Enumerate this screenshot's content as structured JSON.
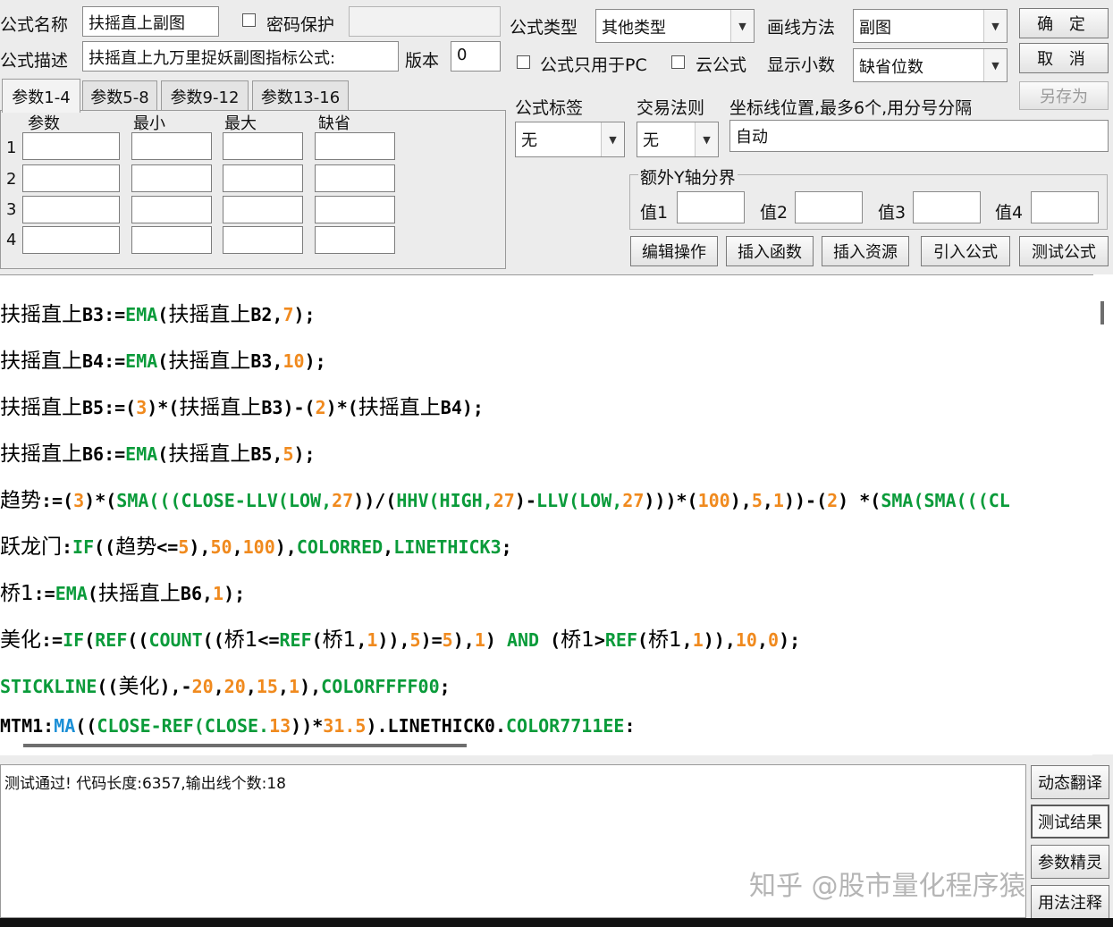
{
  "header": {
    "name_label": "公式名称",
    "name_value": "扶摇直上副图",
    "password_label": "密码保护",
    "desc_label": "公式描述",
    "desc_value": "扶摇直上九万里捉妖副图指标公式:",
    "version_label": "版本",
    "version_value": "0",
    "type_label": "公式类型",
    "type_value": "其他类型",
    "draw_label": "画线方法",
    "draw_value": "副图",
    "pc_only_label": "公式只用于PC",
    "cloud_label": "云公式",
    "decimal_label": "显示小数",
    "decimal_value": "缺省位数"
  },
  "buttons": {
    "ok": "确 定",
    "cancel": "取 消",
    "save_as": "另存为",
    "edit": "编辑操作",
    "insert_func": "插入函数",
    "insert_res": "插入资源",
    "import": "引入公式",
    "test": "测试公式"
  },
  "tabs": [
    {
      "label": "参数1-4"
    },
    {
      "label": "参数5-8"
    },
    {
      "label": "参数9-12"
    },
    {
      "label": "参数13-16"
    }
  ],
  "params": {
    "columns": [
      "参数",
      "最小",
      "最大",
      "缺省"
    ],
    "rows": [
      "1",
      "2",
      "3",
      "4"
    ]
  },
  "options": {
    "tag_label": "公式标签",
    "tag_value": "无",
    "rule_label": "交易法则",
    "rule_value": "无",
    "axis_label": "坐标线位置,最多6个,用分号分隔",
    "axis_value": "自动",
    "yaxis_group": "额外Y轴分界",
    "v1": "值1",
    "v2": "值2",
    "v3": "值3",
    "v4": "值4"
  },
  "code": {
    "l1": {
      "a": "扶摇直上",
      "b": "B3:=",
      "f": "EMA",
      "c": "(",
      "d": "扶摇直上",
      "e": "B2,",
      "n": "7",
      "g": ");"
    },
    "l2": {
      "a": "扶摇直上",
      "b": "B4:=",
      "f": "EMA",
      "c": "(",
      "d": "扶摇直上",
      "e": "B3,",
      "n": "10",
      "g": ");"
    },
    "l3": {
      "a": "扶摇直上",
      "b": "B5:=(",
      "n1": "3",
      "c": ")*(",
      "d": "扶摇直上",
      "e": "B3)-(",
      "n2": "2",
      "f": ")*(",
      "h": "扶摇直上",
      "i": "B4);"
    },
    "l4": {
      "a": "扶摇直上",
      "b": "B6:=",
      "f": "EMA",
      "c": "(",
      "d": "扶摇直上",
      "e": "B5,",
      "n": "5",
      "g": ");"
    },
    "l5": {
      "a": "趋势",
      "b": ":=(",
      "n1": "3",
      "c": ")*(",
      "f1": "SMA(((CLOSE-LLV(LOW,",
      "n2": "27",
      "c2": "))/(",
      "f2": "HHV(HIGH,",
      "n3": "27",
      "c3": ")-",
      "f3": "LLV(LOW,",
      "n4": "27",
      "c4": ")))*(",
      "n5": "100",
      "c5": "),",
      "n6": "5",
      "c6": ",",
      "n7": "1",
      "c7": "))-(",
      "n8": "2",
      "c8": ") *(",
      "f4": "SMA(SMA(((CL"
    },
    "l6": {
      "a": "跃龙门",
      "b": ":",
      "f1": "IF",
      "c": "((",
      "d": "趋势",
      "e": "<=",
      "n1": "5",
      "c2": "),",
      "n2": "50",
      "c3": ",",
      "n3": "100",
      "c4": "),",
      "f2": "COLORRED",
      "c5": ",",
      "f3": "LINETHICK3",
      "c6": ";"
    },
    "l7": {
      "a": "桥1",
      "b": ":=",
      "f": "EMA",
      "c": "(",
      "d": "扶摇直上",
      "e": "B6,",
      "n": "1",
      "g": ");"
    },
    "l8": {
      "a": "美化",
      "b": ":=",
      "f1": "IF",
      "c": "(",
      "f2": "REF",
      "c2": "((",
      "f3": "COUNT",
      "c3": "((",
      "d": "桥1",
      "e": "<=",
      "f4": "REF",
      "c4": "(",
      "d2": "桥1",
      "c5": ",",
      "n1": "1",
      "c6": ")),",
      "n2": "5",
      "c7": ")=",
      "n3": "5",
      "c8": "),",
      "n4": "1",
      "c9": ") ",
      "f5": "AND",
      "c10": " (",
      "d3": "桥1",
      "c11": ">",
      "f6": "REF",
      "c12": "(",
      "d4": "桥1",
      "c13": ",",
      "n5": "1",
      "c14": ")),",
      "n6": "10",
      "c15": ",",
      "n7": "0",
      "c16": ");"
    },
    "l9": {
      "f1": "STICKLINE",
      "c": "((",
      "d": "美化",
      "c2": "),-",
      "n1": "20",
      "c3": ",",
      "n2": "20",
      "c4": ",",
      "n3": "15",
      "c5": ",",
      "n4": "1",
      "c6": "),",
      "f2": "COLORFFFF00",
      "c7": ";"
    },
    "l10": {
      "b": "MTM1:",
      "f1": "MA",
      "c": "((",
      "f2": "CLOSE-REF(CLOSE.",
      "n1": "13",
      "c2": "))*",
      "n2": "31.5",
      "c3": ").LINETHICK0.",
      "f3": "COLOR7711EE",
      "c4": ":"
    }
  },
  "output": {
    "message": "测试通过! 代码长度:6357,输出线个数:18"
  },
  "side_buttons": {
    "translate": "动态翻译",
    "result": "测试结果",
    "wizard": "参数精灵",
    "usage": "用法注释"
  },
  "watermark": "知乎 @股市量化程序猿"
}
